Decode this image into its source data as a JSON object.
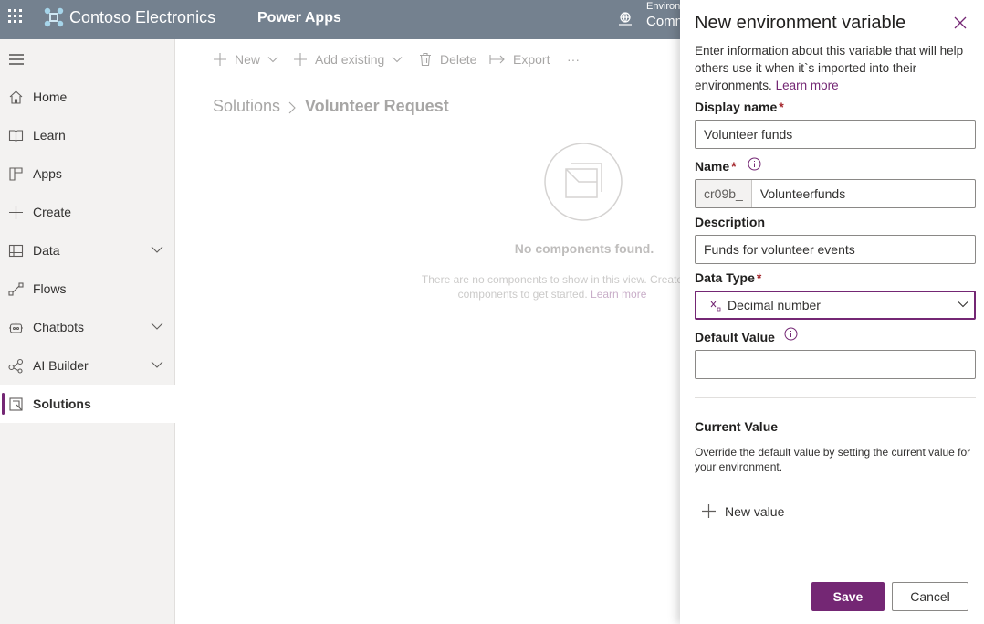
{
  "header": {
    "brand": "Contoso Electronics",
    "app": "Power Apps",
    "environment_label": "Environ",
    "environment_value": "Comm"
  },
  "sidebar": {
    "items": [
      {
        "label": "Home",
        "icon": "home-icon"
      },
      {
        "label": "Learn",
        "icon": "book-icon"
      },
      {
        "label": "Apps",
        "icon": "apps-icon"
      },
      {
        "label": "Create",
        "icon": "plus-icon"
      },
      {
        "label": "Data",
        "icon": "table-icon",
        "expandable": true
      },
      {
        "label": "Flows",
        "icon": "flow-icon"
      },
      {
        "label": "Chatbots",
        "icon": "bot-icon",
        "expandable": true
      },
      {
        "label": "AI Builder",
        "icon": "ai-icon",
        "expandable": true
      },
      {
        "label": "Solutions",
        "icon": "solutions-icon",
        "active": true
      }
    ]
  },
  "commandbar": {
    "new": "New",
    "add_existing": "Add existing",
    "delete": "Delete",
    "export": "Export",
    "more": "···"
  },
  "breadcrumb": {
    "root": "Solutions",
    "current": "Volunteer Request"
  },
  "empty_state": {
    "title": "No components found.",
    "text": "There are no components to show in this view. Create components to get started.",
    "link": "Learn more"
  },
  "panel": {
    "title": "New environment variable",
    "intro": "Enter information about this variable that will help others use it when it`s imported into their environments.",
    "intro_link": "Learn more",
    "display_name_label": "Display name",
    "display_name_value": "Volunteer funds",
    "name_label": "Name",
    "name_prefix": "cr09b_",
    "name_value": "Volunteerfunds",
    "description_label": "Description",
    "description_value": "Funds for volunteer events",
    "data_type_label": "Data Type",
    "data_type_value": "Decimal number",
    "default_value_label": "Default Value",
    "default_value_value": "",
    "current_value_title": "Current Value",
    "current_value_desc": "Override the default value by setting the current value for your environment.",
    "new_value": "New value",
    "required_mark": "*",
    "save": "Save",
    "cancel": "Cancel"
  },
  "colors": {
    "header_bg": "#74818f",
    "accent": "#742774",
    "required": "#a4262c"
  }
}
